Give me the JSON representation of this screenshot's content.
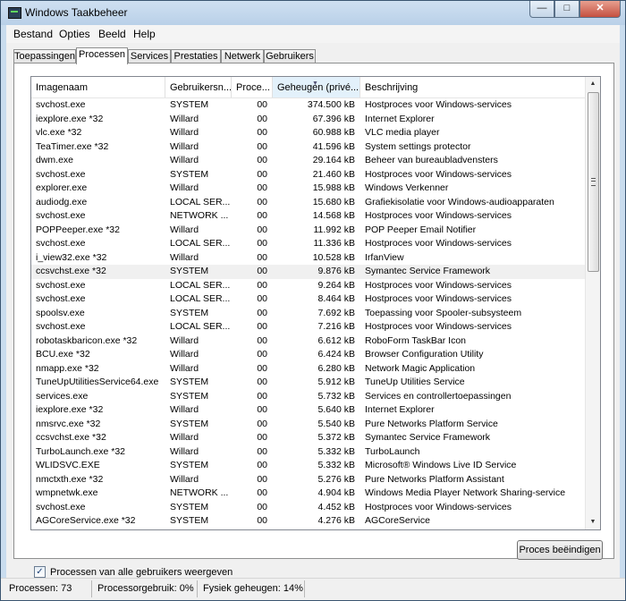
{
  "window": {
    "title": "Windows Taakbeheer"
  },
  "menu": [
    {
      "label": "Bestand"
    },
    {
      "label": "Opties"
    },
    {
      "label": "Beeld"
    },
    {
      "label": "Help"
    }
  ],
  "tabs": [
    {
      "label": "Toepassingen"
    },
    {
      "label": "Processen",
      "active": true
    },
    {
      "label": "Services"
    },
    {
      "label": "Prestaties"
    },
    {
      "label": "Netwerk"
    },
    {
      "label": "Gebruikers"
    }
  ],
  "columns": [
    "Imagenaam",
    "Gebruikersn...",
    "Proce...",
    "Geheugen (privé...",
    "Beschrijving"
  ],
  "processes": [
    [
      "svchost.exe",
      "SYSTEM",
      "00",
      "374.500 kB",
      "Hostproces voor Windows-services"
    ],
    [
      "iexplore.exe *32",
      "Willard",
      "00",
      "67.396 kB",
      "Internet Explorer"
    ],
    [
      "vlc.exe *32",
      "Willard",
      "00",
      "60.988 kB",
      "VLC media player"
    ],
    [
      "TeaTimer.exe *32",
      "Willard",
      "00",
      "41.596 kB",
      "System settings protector"
    ],
    [
      "dwm.exe",
      "Willard",
      "00",
      "29.164 kB",
      "Beheer van bureaubladvensters"
    ],
    [
      "svchost.exe",
      "SYSTEM",
      "00",
      "21.460 kB",
      "Hostproces voor Windows-services"
    ],
    [
      "explorer.exe",
      "Willard",
      "00",
      "15.988 kB",
      "Windows Verkenner"
    ],
    [
      "audiodg.exe",
      "LOCAL SER...",
      "00",
      "15.680 kB",
      "Grafiekisolatie voor Windows-audioapparaten"
    ],
    [
      "svchost.exe",
      "NETWORK ...",
      "00",
      "14.568 kB",
      "Hostproces voor Windows-services"
    ],
    [
      "POPPeeper.exe *32",
      "Willard",
      "00",
      "11.992 kB",
      "POP Peeper Email Notifier"
    ],
    [
      "svchost.exe",
      "LOCAL SER...",
      "00",
      "11.336 kB",
      "Hostproces voor Windows-services"
    ],
    [
      "i_view32.exe *32",
      "Willard",
      "00",
      "10.528 kB",
      "IrfanView"
    ],
    [
      "ccsvchst.exe *32",
      "SYSTEM",
      "00",
      "9.876 kB",
      "Symantec Service Framework"
    ],
    [
      "svchost.exe",
      "LOCAL SER...",
      "00",
      "9.264 kB",
      "Hostproces voor Windows-services"
    ],
    [
      "svchost.exe",
      "LOCAL SER...",
      "00",
      "8.464 kB",
      "Hostproces voor Windows-services"
    ],
    [
      "spoolsv.exe",
      "SYSTEM",
      "00",
      "7.692 kB",
      "Toepassing voor Spooler-subsysteem"
    ],
    [
      "svchost.exe",
      "LOCAL SER...",
      "00",
      "7.216 kB",
      "Hostproces voor Windows-services"
    ],
    [
      "robotaskbaricon.exe *32",
      "Willard",
      "00",
      "6.612 kB",
      "RoboForm TaskBar Icon"
    ],
    [
      "BCU.exe *32",
      "Willard",
      "00",
      "6.424 kB",
      "Browser Configuration Utility"
    ],
    [
      "nmapp.exe *32",
      "Willard",
      "00",
      "6.280 kB",
      "Network Magic Application"
    ],
    [
      "TuneUpUtilitiesService64.exe",
      "SYSTEM",
      "00",
      "5.912 kB",
      "TuneUp Utilities Service"
    ],
    [
      "services.exe",
      "SYSTEM",
      "00",
      "5.732 kB",
      "Services en controllertoepassingen"
    ],
    [
      "iexplore.exe *32",
      "Willard",
      "00",
      "5.640 kB",
      "Internet Explorer"
    ],
    [
      "nmsrvc.exe *32",
      "SYSTEM",
      "00",
      "5.540 kB",
      "Pure Networks Platform Service"
    ],
    [
      "ccsvchst.exe *32",
      "Willard",
      "00",
      "5.372 kB",
      "Symantec Service Framework"
    ],
    [
      "TurboLaunch.exe *32",
      "Willard",
      "00",
      "5.332 kB",
      "TurboLaunch"
    ],
    [
      "WLIDSVC.EXE",
      "SYSTEM",
      "00",
      "5.332 kB",
      "Microsoft® Windows Live ID Service"
    ],
    [
      "nmctxth.exe *32",
      "Willard",
      "00",
      "5.276 kB",
      "Pure Networks Platform Assistant"
    ],
    [
      "wmpnetwk.exe",
      "NETWORK ...",
      "00",
      "4.904 kB",
      "Windows Media Player Network Sharing-service"
    ],
    [
      "svchost.exe",
      "SYSTEM",
      "00",
      "4.452 kB",
      "Hostproces voor Windows-services"
    ],
    [
      "AGCoreService.exe *32",
      "SYSTEM",
      "00",
      "4.276 kB",
      "AGCoreService"
    ]
  ],
  "show_all_users": {
    "label": "Processen van alle gebruikers weergeven",
    "checked": true
  },
  "end_process_button": "Proces beëindigen",
  "status": {
    "processes": "Processen: 73",
    "cpu": "Processorgebruik: 0%",
    "memory": "Fysiek geheugen: 14%"
  }
}
